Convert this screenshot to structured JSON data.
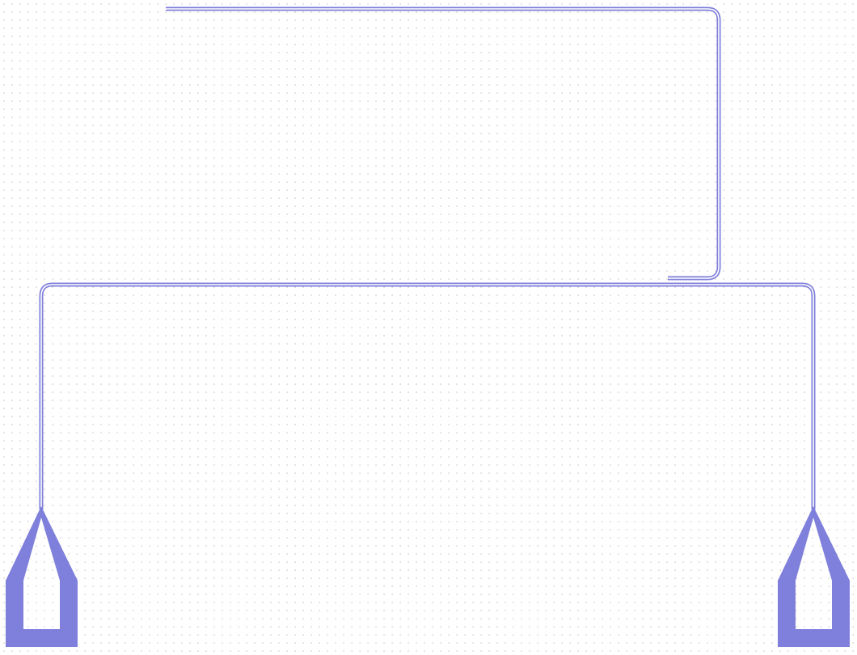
{
  "colors": {
    "background": "#ffffff",
    "grid_dot": "#b8b8b8",
    "trace": "#7f7fdc",
    "trace_gap": "#ffffff",
    "pad_fill": "#7f7fdc"
  }
}
